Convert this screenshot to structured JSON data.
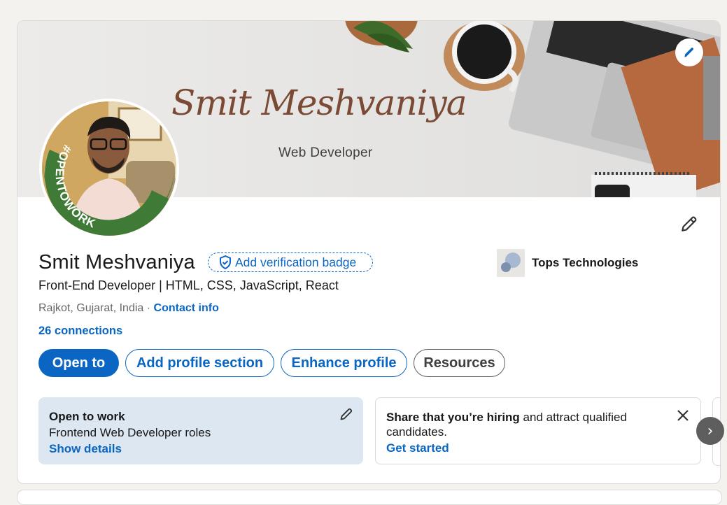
{
  "banner": {
    "name": "Smit Meshvaniya",
    "subtitle": "Web Developer"
  },
  "avatar": {
    "frame_text": "#OPENTOWORK",
    "frame_color": "#3f7a36"
  },
  "profile": {
    "name": "Smit Meshvaniya",
    "verify_label": "Add verification badge",
    "headline": "Front-End Developer | HTML, CSS, JavaScript, React",
    "location": "Rajkot, Gujarat, India",
    "separator": " · ",
    "contact_label": "Contact info",
    "connections": "26 connections"
  },
  "company": {
    "name": "Tops Technologies"
  },
  "actions": {
    "open_to": "Open to",
    "add_section": "Add profile section",
    "enhance": "Enhance profile",
    "resources": "Resources"
  },
  "open_to_work_card": {
    "title": "Open to work",
    "roles": "Frontend Web Developer roles",
    "link": "Show details"
  },
  "hiring_card": {
    "bold": "Share that you’re hiring",
    "rest": " and attract qualified candidates.",
    "link": "Get started"
  },
  "carousel": {
    "next_icon": "›"
  },
  "colors": {
    "accent": "#0a66c2",
    "otw_card_bg": "#dde7f1",
    "page_bg": "#f4f2ee"
  }
}
